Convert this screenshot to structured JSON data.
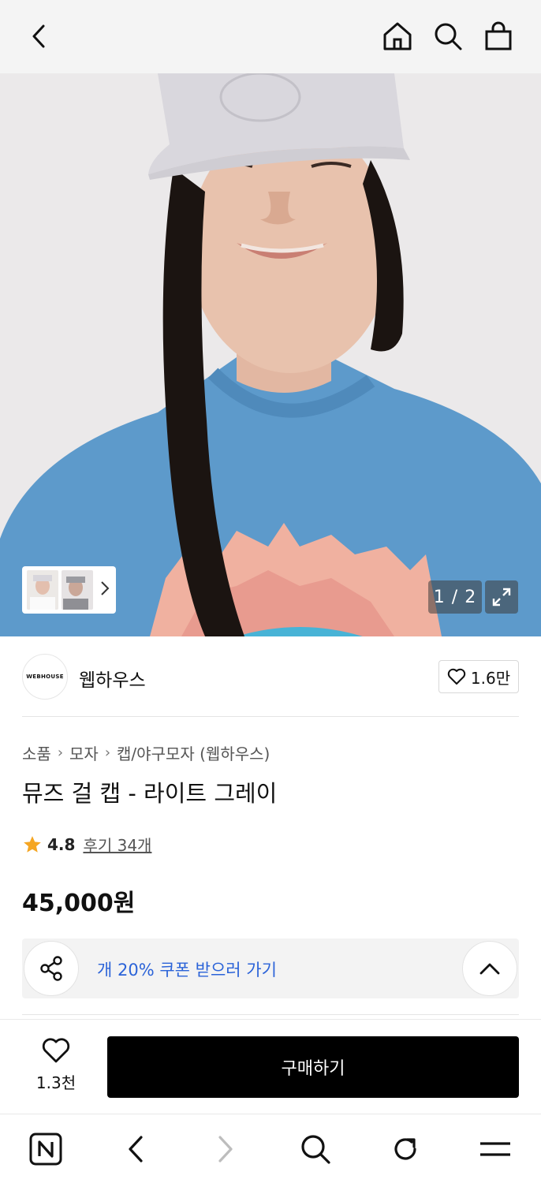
{
  "gallery": {
    "counter": "1 / 2"
  },
  "brand": {
    "logo_text": "WEBHOUSE",
    "name": "웹하우스",
    "likes": "1.6만"
  },
  "breadcrumbs": [
    "소품",
    "모자",
    "캡/야구모자 (웹하우스)"
  ],
  "product": {
    "title": "뮤즈 걸 캡 - 라이트 그레이",
    "rating": "4.8",
    "reviews": "후기 34개",
    "price": "45,000원"
  },
  "coupon": {
    "text": "개 20% 쿠폰 받으러 가기",
    "accent_color": "#2b63d8"
  },
  "bottom": {
    "wish_count": "1.3천",
    "buy_label": "구매하기"
  },
  "icons": {
    "top": [
      "back-icon",
      "home-icon",
      "search-icon",
      "bag-icon"
    ],
    "browser": [
      "naver-icon",
      "back-icon",
      "forward-icon",
      "search-icon",
      "refresh-icon",
      "menu-icon"
    ]
  },
  "colors": {
    "star": "#f5a623",
    "buy_button": "#000000",
    "topbar": "#f4f4f4"
  }
}
